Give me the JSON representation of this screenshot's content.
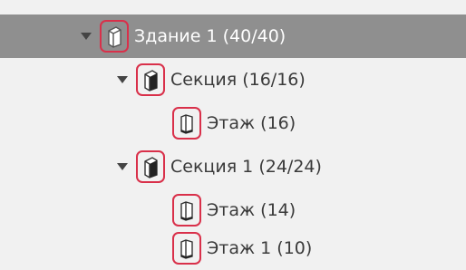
{
  "tree": {
    "nodes": [
      {
        "label": "Здание 1",
        "count": "(40/40)",
        "icon": "building-icon",
        "expanded": true,
        "selected": true
      },
      {
        "label": "Секция",
        "count": "(16/16)",
        "icon": "section-icon",
        "expanded": true,
        "selected": false
      },
      {
        "label": "Этаж",
        "count": "(16)",
        "icon": "floor-icon",
        "expanded": false,
        "selected": false
      },
      {
        "label": "Секция 1",
        "count": "(24/24)",
        "icon": "section-icon",
        "expanded": true,
        "selected": false
      },
      {
        "label": "Этаж",
        "count": "(14)",
        "icon": "floor-icon",
        "expanded": false,
        "selected": false
      },
      {
        "label": "Этаж 1",
        "count": "(10)",
        "icon": "floor-icon",
        "expanded": false,
        "selected": false
      }
    ]
  },
  "colors": {
    "background": "#f1f1f1",
    "selected_row": "#8f8f8f",
    "highlight_border": "#d9304a",
    "text": "#3a3a3a"
  }
}
